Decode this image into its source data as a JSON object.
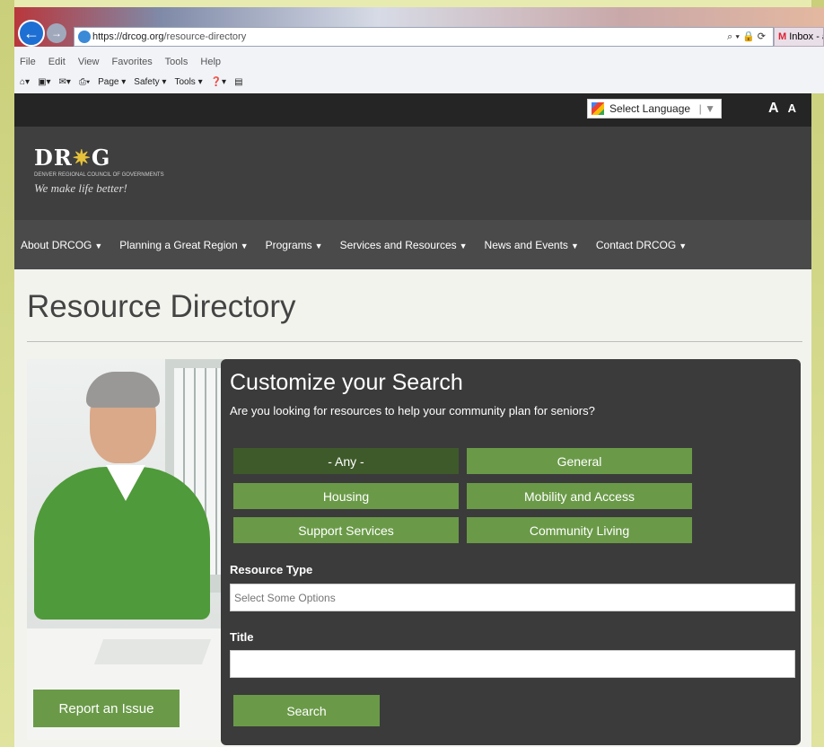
{
  "browser": {
    "url_host": "https://drcog.org",
    "url_path": "/resource-directory",
    "mail_tab": "Inbox - a",
    "menu": [
      "File",
      "Edit",
      "View",
      "Favorites",
      "Tools",
      "Help"
    ],
    "commands": [
      "Page ▾",
      "Safety ▾",
      "Tools ▾"
    ]
  },
  "topbar": {
    "language_label": "Select Language",
    "font_large": "A",
    "font_small": "A"
  },
  "logo": {
    "name_left": "DR",
    "name_right": "G",
    "subtitle": "DENVER REGIONAL COUNCIL OF GOVERNMENTS",
    "tagline": "We make life better!"
  },
  "nav": [
    {
      "label": "About DRCOG"
    },
    {
      "label": "Planning a Great Region"
    },
    {
      "label": "Programs"
    },
    {
      "label": "Services and Resources"
    },
    {
      "label": "News and Events"
    },
    {
      "label": "Contact DRCOG"
    }
  ],
  "page": {
    "title": "Resource Directory",
    "report_button": "Report an Issue"
  },
  "search": {
    "title": "Customize your Search",
    "subtitle": "Are you looking for resources to help your community plan for seniors?",
    "categories": [
      "- Any -",
      "General",
      "Housing",
      "Mobility and Access",
      "Support Services",
      "Community Living"
    ],
    "active_category": "- Any -",
    "resource_type_label": "Resource Type",
    "resource_type_placeholder": "Select Some Options",
    "title_label": "Title",
    "title_value": "",
    "search_button": "Search"
  },
  "colors": {
    "accent_green": "#6a9a48",
    "active_green": "#3e5a2a",
    "panel_bg": "#3b3b3b"
  }
}
